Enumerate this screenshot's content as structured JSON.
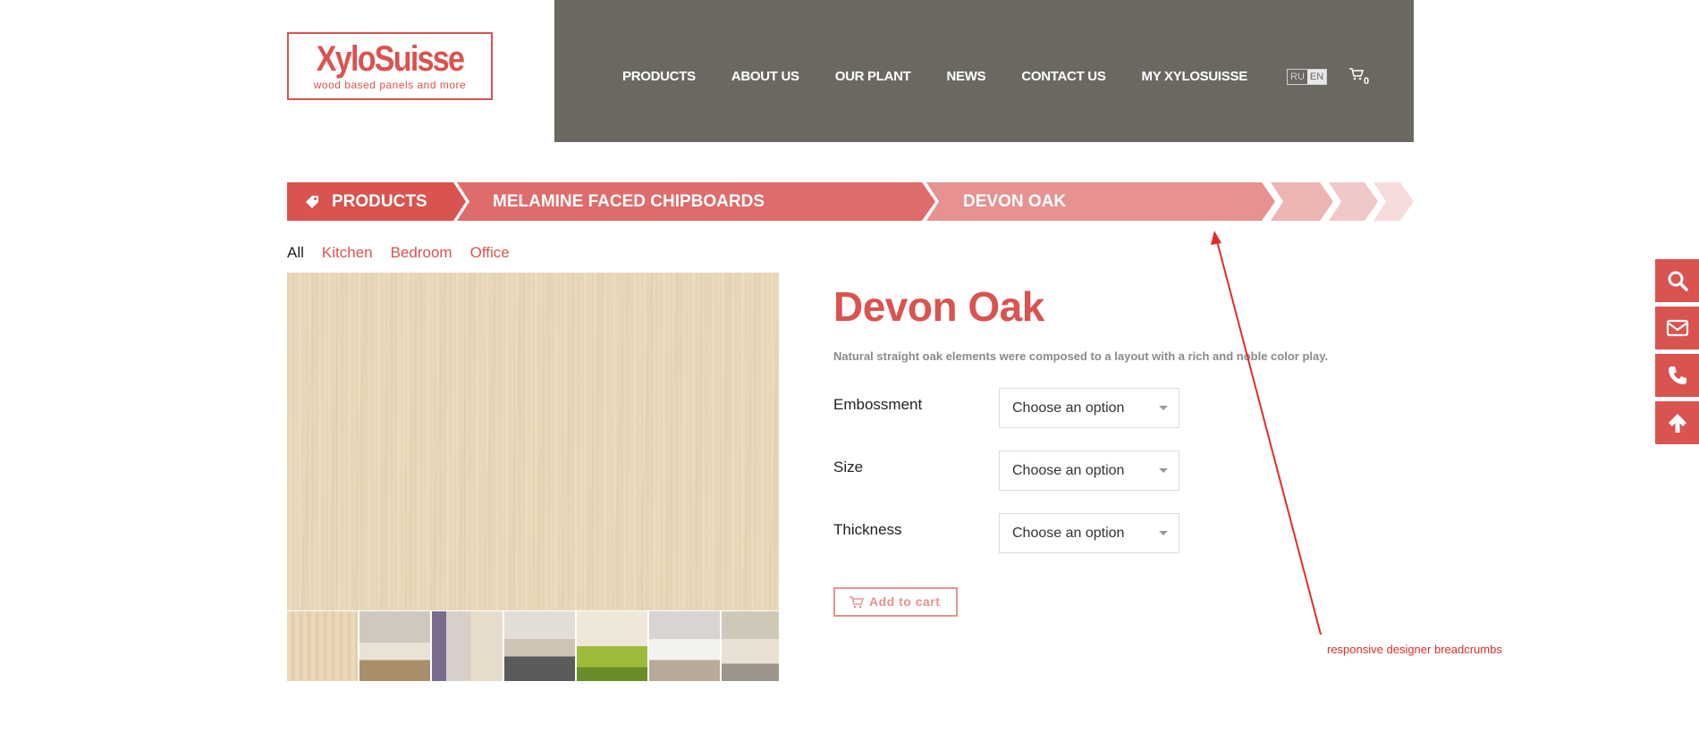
{
  "logo": {
    "main": "XylοSuisse",
    "tagline": "wood based panels and more"
  },
  "nav": {
    "items": [
      {
        "label": "PRODUCTS"
      },
      {
        "label": "ABOUT US"
      },
      {
        "label": "OUR PLANT"
      },
      {
        "label": "NEWS"
      },
      {
        "label": "CONTACT US"
      },
      {
        "label": "MY XYLOSUISSE"
      }
    ],
    "languages": {
      "ru": "RU",
      "en": "EN",
      "active": "EN"
    },
    "cart_count": "0"
  },
  "breadcrumbs": [
    {
      "label": "PRODUCTS",
      "color": "#d9534f"
    },
    {
      "label": "MELAMINE FACED CHIPBOARDS",
      "color": "#df6b6a"
    },
    {
      "label": "DEVON OAK",
      "color": "#e69291"
    }
  ],
  "filters": {
    "items": [
      {
        "label": "All",
        "active": true
      },
      {
        "label": "Kitchen",
        "active": false
      },
      {
        "label": "Bedroom",
        "active": false
      },
      {
        "label": "Office",
        "active": false
      }
    ]
  },
  "product": {
    "title": "Devon Oak",
    "description": "Natural straight oak elements were composed to a layout with a rich and noble color play.",
    "options": [
      {
        "label": "Embossment",
        "value": "Choose an option"
      },
      {
        "label": "Size",
        "value": "Choose an option"
      },
      {
        "label": "Thickness",
        "value": "Choose an option"
      }
    ],
    "add_to_cart": "Add to cart"
  },
  "thumbnails": [
    {
      "name": "decor-swatch"
    },
    {
      "name": "bedroom-scene"
    },
    {
      "name": "kids-room-scene"
    },
    {
      "name": "kitchen-scene"
    },
    {
      "name": "living-room-scene"
    },
    {
      "name": "conference-room-scene"
    },
    {
      "name": "office-scene"
    }
  ],
  "annotation": {
    "text": "responsive designer breadcrumbs",
    "color": "#e32b2b"
  },
  "side_buttons": [
    "search-icon",
    "envelope-icon",
    "phone-icon",
    "arrow-up-icon"
  ],
  "colors": {
    "accent": "#d9534f",
    "header_bg": "#6b6862"
  }
}
